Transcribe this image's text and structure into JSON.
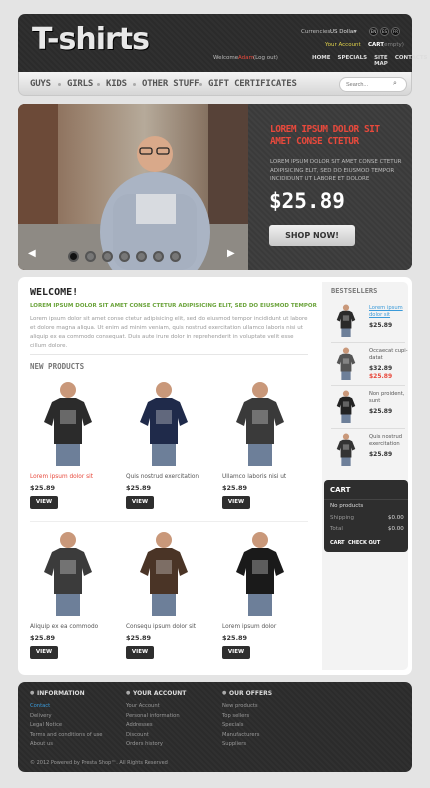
{
  "header": {
    "logo_text": "T-shirts",
    "currencies_label": "Currencies:",
    "currency_value": "US Dollar",
    "flags": [
      "EN",
      "ES",
      "FR"
    ],
    "welcome": "Welcome",
    "user_name": "Adam",
    "logout": "(Log out)",
    "your_account": "Your Account",
    "cart_label": "CART",
    "cart_status": "(empty)",
    "nav": [
      "HOME",
      "SPECIALS",
      "SITE MAP",
      "CONTACTS"
    ]
  },
  "menu": {
    "items": [
      "GUYS",
      "GIRLS",
      "KIDS",
      "OTHER STUFF",
      "GIFT CERTIFICATES"
    ],
    "search_placeholder": "Search..."
  },
  "slider": {
    "title": "LOREM IPSUM DOLOR SIT AMET CONSE CTETUR",
    "text": "LOREM IPSUM DOLOR SIT AMET CONSE CTETUR ADIPISICING ELIT, SED DO EIUSMOD TEMPOR INCIDIDUNT UT LABORE ET DOLORE",
    "price": "$25.89",
    "button": "SHOP NOW!",
    "dots": 7,
    "active_dot": 1
  },
  "welcome": {
    "title": "WELCOME!",
    "subtitle": "LOREM IPSUM DOLOR SIT AMET CONSE CTETUR ADIPISICING ELIT, SED DO EIUSMOD TEMPOR",
    "body": "Lorem ipsum dolor sit amet conse ctetur adipisicing elit, sed do eiusmod tempor incididunt ut labore et dolore magna aliqua. Ut enim ad minim veniam, quis nostrud exercitation ullamco laboris nisi ut aliquip ex ea commodo consequat. Duis aute irure dolor in reprehenderit in voluptate velit esse cillum dolore."
  },
  "new_products": {
    "title": "NEW PRODUCTS",
    "view_label": "VIEW",
    "items": [
      {
        "name": "Lorem ipsum dolor sit",
        "price": "$25.89",
        "shirt": "#2b2b2b",
        "highlight": true
      },
      {
        "name": "Quis nostrud exercitation",
        "price": "$25.89",
        "shirt": "#1f2a4a",
        "highlight": false
      },
      {
        "name": "Ullamco laboris nisi ut",
        "price": "$25.89",
        "shirt": "#3a3a3a",
        "highlight": false
      },
      {
        "name": "Aliquip ex ea commodo",
        "price": "$25.89",
        "shirt": "#3b3b3b",
        "highlight": false
      },
      {
        "name": "Consequ ipsum dolor sit",
        "price": "$25.89",
        "shirt": "#4a3426",
        "highlight": false
      },
      {
        "name": "Lorem ipsum dolor",
        "price": "$25.89",
        "shirt": "#1a1a1a",
        "highlight": false
      }
    ]
  },
  "bestsellers": {
    "title": "BESTSELLERS",
    "items": [
      {
        "name": "Lorem ipsum dolor sit",
        "price": "$25.89",
        "old_price": "",
        "shirt": "#2a2a2a",
        "link": true
      },
      {
        "name": "Occaecat cupi-datat",
        "price": "$32.89",
        "old_price": "$25.89",
        "shirt": "#555555",
        "link": false
      },
      {
        "name": "Non proident, sunt",
        "price": "$25.89",
        "old_price": "",
        "shirt": "#222222",
        "link": false
      },
      {
        "name": "Quis nostrud exercitation",
        "price": "$25.89",
        "old_price": "",
        "shirt": "#333333",
        "link": false
      }
    ]
  },
  "cart": {
    "title": "CART",
    "no_products": "No products",
    "shipping_label": "Shipping",
    "shipping_value": "$0.00",
    "total_label": "Total",
    "total_value": "$0.00",
    "cart_link": "CART",
    "checkout_link": "CHECK OUT"
  },
  "footer": {
    "columns": [
      {
        "title": "INFORMATION",
        "links": [
          "Contact",
          "Delivery",
          "Legal Notice",
          "Terms and conditions of use",
          "About us"
        ]
      },
      {
        "title": "YOUR ACCOUNT",
        "links": [
          "Your Account",
          "Personal information",
          "Addresses",
          "Discount",
          "Orders history"
        ]
      },
      {
        "title": "OUR OFFERS",
        "links": [
          "New products",
          "Top sellers",
          "Specials",
          "Manufacturers",
          "Suppliers"
        ]
      }
    ],
    "copyright": "© 2012 Powered by Presta Shop™. All Rights Reserved"
  },
  "colors": {
    "accent_red": "#e8493c",
    "accent_green": "#6aa33a",
    "dark_panel": "#2b2b2b",
    "link_blue": "#3a9ad9"
  }
}
